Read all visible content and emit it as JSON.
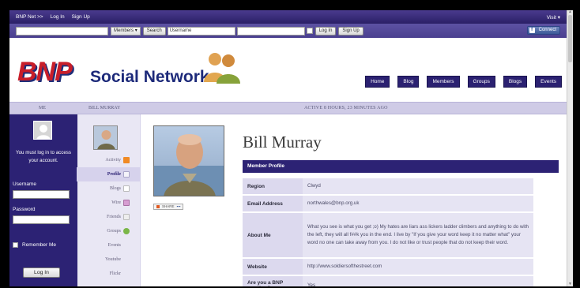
{
  "topbar": {
    "items": [
      "BNP Net >>",
      "Log In",
      "Sign Up"
    ],
    "visit": "Visit"
  },
  "searchbar": {
    "members_select": "Members",
    "search_button": "Search",
    "username_field": "Username",
    "login_button": "Log In",
    "signup_button": "Sign Up",
    "connect_button": "Connect"
  },
  "header": {
    "logo_text": "BNP",
    "site_name": "Social Network",
    "nav": [
      "Home",
      "Blog",
      "Members",
      "Groups",
      "Blogs",
      "Events"
    ]
  },
  "strip": {
    "me": "ME",
    "user": "BILL MURRAY",
    "active": "ACTIVE 8 HOURS, 23 MINUTES AGO"
  },
  "login": {
    "message": "You must log in to access your account.",
    "username_label": "Username",
    "password_label": "Password",
    "remember_label": "Remember Me",
    "button": "Log In"
  },
  "subnav": [
    {
      "label": "Activity",
      "icon": "rss-icon",
      "color": "#f08a24"
    },
    {
      "label": "Profile",
      "icon": "profile-card-icon",
      "color": "#b9b6d6"
    },
    {
      "label": "Blogs",
      "icon": "document-icon",
      "color": "#c9c9c9"
    },
    {
      "label": "Wire",
      "icon": "wire-icon",
      "color": "#c78fc4"
    },
    {
      "label": "Friends",
      "icon": "friends-icon",
      "color": "#d2d2d2"
    },
    {
      "label": "Groups",
      "icon": "groups-icon",
      "color": "#7ab648"
    },
    {
      "label": "Events",
      "icon": "",
      "color": ""
    },
    {
      "label": "Youtube",
      "icon": "",
      "color": ""
    },
    {
      "label": "Flickr",
      "icon": "",
      "color": ""
    }
  ],
  "profile": {
    "name": "Bill Murray",
    "section_title": "Member Profile",
    "share_label": "SHARE",
    "fields": [
      {
        "key": "Region",
        "value": "Clwyd"
      },
      {
        "key": "Email Address",
        "value": "northwales@bnp.org.uk"
      },
      {
        "key": "About Me",
        "value": "What you see is what you get ;o) My hates are liars ass lickers ladder climbers and anything to do with the left, they will all f##k you in the end. I live by \"If you give your word keep it no matter what\" your word no one can take away from you. I do not like or trust people that do not keep their word."
      },
      {
        "key": "Website",
        "value": "http://www.soldiersofthestreet.com"
      },
      {
        "key": "Are you a BNP member?",
        "value": "Yes"
      }
    ]
  },
  "colors": {
    "brand_dark": "#2c2274",
    "brand_light": "#dcd9ee",
    "logo_red": "#c81e2a",
    "facebook": "#3b5998"
  }
}
